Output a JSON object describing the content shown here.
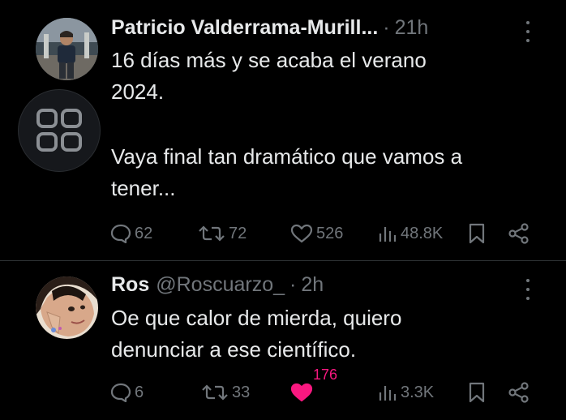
{
  "tweets": [
    {
      "name": "Patricio Valderrama-Murill...",
      "handle": "",
      "time": "21h",
      "text_line1": "16 días más y se acaba el verano\n2024.",
      "text_line2": "Vaya final tan dramático que vamos a\ntener...",
      "replies": "62",
      "retweets": "72",
      "likes": "526",
      "views": "48.8K"
    },
    {
      "name": "Ros",
      "handle": "@Roscuarzo_",
      "time": "2h",
      "text_line1": "Oe que calor de mierda, quiero\ndenunciar a ese científico.",
      "replies": "6",
      "retweets": "33",
      "likes": "176",
      "views": "3.3K"
    }
  ],
  "colors": {
    "background": "#000000",
    "text": "#e7e9ea",
    "muted": "#71767b",
    "like": "#f91880",
    "divider": "#2f3336"
  },
  "icons": [
    "reply-icon",
    "retweet-icon",
    "like-icon",
    "views-icon",
    "bookmark-icon",
    "share-icon",
    "more-icon",
    "grid-icon"
  ]
}
